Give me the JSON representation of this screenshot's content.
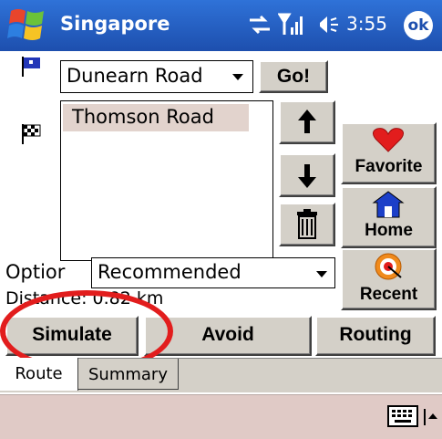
{
  "titlebar": {
    "title": "Singapore",
    "time": "3:55",
    "ok_label": "ok"
  },
  "route": {
    "from_value": "Dunearn Road",
    "go_label": "Go!",
    "destinations": [
      "Thomson Road"
    ],
    "option_label": "Optior",
    "option_value": "Recommended",
    "distance_text": "Distance: 0.82 km"
  },
  "side_buttons": {
    "favorite": "Favorite",
    "home": "Home",
    "recent": "Recent"
  },
  "bottom_buttons": {
    "simulate": "Simulate",
    "avoid": "Avoid",
    "routing": "Routing"
  },
  "tabs": [
    {
      "label": "Route"
    },
    {
      "label": "Summary"
    }
  ],
  "colors": {
    "titlebar": "#1d4fae",
    "highlight_circle": "#e21d1d",
    "menubar": "#e0cac6",
    "selection": "#e2d3cd"
  }
}
